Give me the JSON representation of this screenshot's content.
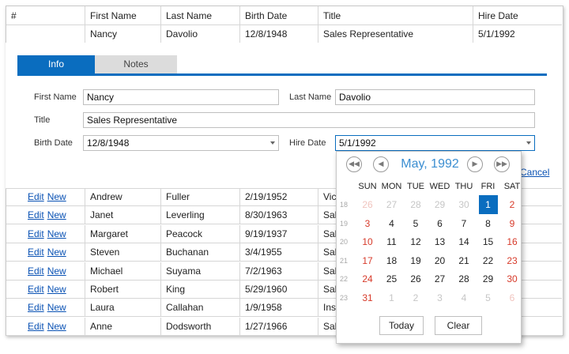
{
  "grid": {
    "columns": [
      "#",
      "First Name",
      "Last Name",
      "Birth Date",
      "Title",
      "Hire Date"
    ],
    "editing_row": {
      "first": "Nancy",
      "last": "Davolio",
      "birth": "12/8/1948",
      "title": "Sales Representative",
      "hire": "5/1/1992"
    },
    "rows": [
      {
        "edit": "Edit",
        "new": "New",
        "first": "Andrew",
        "last": "Fuller",
        "birth": "2/19/1952",
        "title": "Vic"
      },
      {
        "edit": "Edit",
        "new": "New",
        "first": "Janet",
        "last": "Leverling",
        "birth": "8/30/1963",
        "title": "Sal"
      },
      {
        "edit": "Edit",
        "new": "New",
        "first": "Margaret",
        "last": "Peacock",
        "birth": "9/19/1937",
        "title": "Sal"
      },
      {
        "edit": "Edit",
        "new": "New",
        "first": "Steven",
        "last": "Buchanan",
        "birth": "3/4/1955",
        "title": "Sal"
      },
      {
        "edit": "Edit",
        "new": "New",
        "first": "Michael",
        "last": "Suyama",
        "birth": "7/2/1963",
        "title": "Sal"
      },
      {
        "edit": "Edit",
        "new": "New",
        "first": "Robert",
        "last": "King",
        "birth": "5/29/1960",
        "title": "Sal"
      },
      {
        "edit": "Edit",
        "new": "New",
        "first": "Laura",
        "last": "Callahan",
        "birth": "1/9/1958",
        "title": "Ins"
      },
      {
        "edit": "Edit",
        "new": "New",
        "first": "Anne",
        "last": "Dodsworth",
        "birth": "1/27/1966",
        "title": "Sal"
      }
    ]
  },
  "edit_form": {
    "tabs": [
      "Info",
      "Notes"
    ],
    "labels": {
      "first": "First Name",
      "last": "Last Name",
      "title": "Title",
      "birth": "Birth Date",
      "hire": "Hire Date"
    },
    "values": {
      "first": "Nancy",
      "last": "Davolio",
      "title": "Sales Representative",
      "birth": "12/8/1948",
      "hire": "5/1/1992"
    },
    "cancel_label": "Cancel"
  },
  "calendar": {
    "month_title": "May, 1992",
    "weekdays": [
      "SUN",
      "MON",
      "TUE",
      "WED",
      "THU",
      "FRI",
      "SAT"
    ],
    "weeks": [
      "18",
      "19",
      "20",
      "21",
      "22",
      "23"
    ],
    "days": [
      [
        "26",
        "27",
        "28",
        "29",
        "30",
        "1",
        "2"
      ],
      [
        "3",
        "4",
        "5",
        "6",
        "7",
        "8",
        "9"
      ],
      [
        "10",
        "11",
        "12",
        "13",
        "14",
        "15",
        "16"
      ],
      [
        "17",
        "18",
        "19",
        "20",
        "21",
        "22",
        "23"
      ],
      [
        "24",
        "25",
        "26",
        "27",
        "28",
        "29",
        "30"
      ],
      [
        "31",
        "1",
        "2",
        "3",
        "4",
        "5",
        "6"
      ]
    ],
    "selected": "1",
    "today_label": "Today",
    "clear_label": "Clear",
    "nav_icons": [
      "double-left-icon",
      "left-icon",
      "right-icon",
      "double-right-icon"
    ]
  }
}
